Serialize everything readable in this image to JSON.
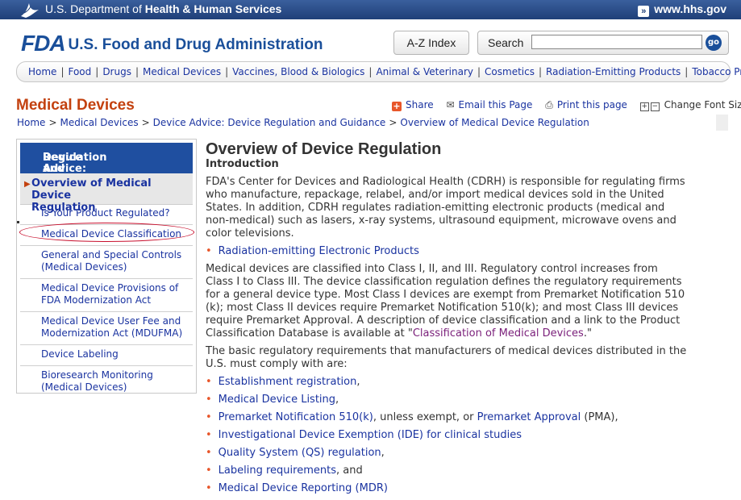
{
  "hhs": {
    "prefix": "U.S. Department of ",
    "dept": "Health & Human Services",
    "link": "www.hhs.gov"
  },
  "header": {
    "logo_mark": "FDA",
    "agency_name": "U.S. Food and Drug Administration",
    "az_index": "A-Z Index",
    "search_label": "Search",
    "search_value": "",
    "search_go": "go"
  },
  "nav": {
    "items": [
      {
        "label": "Home"
      },
      {
        "label": "Food"
      },
      {
        "label": "Drugs"
      },
      {
        "label": "Medical Devices"
      },
      {
        "label": "Vaccines, Blood & Biologics"
      },
      {
        "label": "Animal & Veterinary"
      },
      {
        "label": "Cosmetics"
      },
      {
        "label": "Radiation-Emitting Products"
      },
      {
        "label": "Tobacco Products"
      }
    ]
  },
  "section": {
    "title": "Medical Devices",
    "share": "Share",
    "email": "Email this Page",
    "print": "Print this page",
    "font_size": "Change Font Size"
  },
  "breadcrumb": [
    "Home",
    "Medical Devices",
    "Device Advice: Device Regulation and Guidance",
    "Overview of Medical Device Regulation"
  ],
  "sidebar": {
    "heading_line1": "Device Advice: Device",
    "heading_line2": "Regulation and Guidance",
    "current_line1": "Overview of Medical Device",
    "current_line2": "Regulation",
    "items": [
      {
        "label": "Is Your Product Regulated?"
      },
      {
        "label": "Medical Device Classification"
      },
      {
        "label": "General and Special Controls (Medical Devices)"
      },
      {
        "label": "Medical Device Provisions of FDA Modernization Act"
      },
      {
        "label": "Medical Device User Fee and Modernization Act (MDUFMA)"
      },
      {
        "label": "Device Labeling"
      },
      {
        "label": "Bioresearch Monitoring (Medical Devices)"
      }
    ]
  },
  "main": {
    "title": "Overview of Device Regulation",
    "subhead": "Introduction",
    "intro_lines": [
      "FDA's Center for Devices and Radiological Health (CDRH) is responsible for regulating firms",
      "who manufacture, repackage, relabel, and/or import medical devices sold in the United",
      "States. In addition, CDRH regulates radiation-emitting electronic products (medical and",
      "non-medical) such as lasers, x-ray systems, ultrasound equipment, microwave ovens and",
      "color televisions."
    ],
    "radiation_link": "Radiation-emitting Electronic Products",
    "classes_lines": [
      "Medical devices are classified into Class I, II, and III. Regulatory control increases from",
      "Class I to Class III. The device classification regulation defines the regulatory requirements",
      "for a general device type. Most Class I devices are exempt from Premarket Notification 510",
      "(k); most Class II devices require Premarket Notification 510(k); and most Class III devices",
      "require Premarket Approval. A description of device classification and a link to the Product"
    ],
    "classes_last_prefix": "Classification Database is available at \"",
    "classes_link": "Classification of Medical Devices",
    "classes_last_suffix": ".\"",
    "basic_lines": [
      "The basic regulatory requirements that manufacturers of medical devices distributed in the",
      "U.S. must comply with are:"
    ],
    "requirements": {
      "r1_link": "Establishment registration",
      "r1_suffix": ",",
      "r2_link": "Medical Device Listing",
      "r2_suffix": ",",
      "r3_link": "Premarket Notification 510(k)",
      "r3_mid": ", unless exempt, or ",
      "r3_link2": "Premarket Approval",
      "r3_suffix": " (PMA),",
      "r4_link": "Investigational Device Exemption (IDE) for clinical studies",
      "r5_link": "Quality System (QS) regulation",
      "r5_suffix": ",",
      "r6_link": "Labeling requirements",
      "r6_suffix": ", and",
      "r7_link": "Medical Device Reporting (MDR)"
    }
  }
}
